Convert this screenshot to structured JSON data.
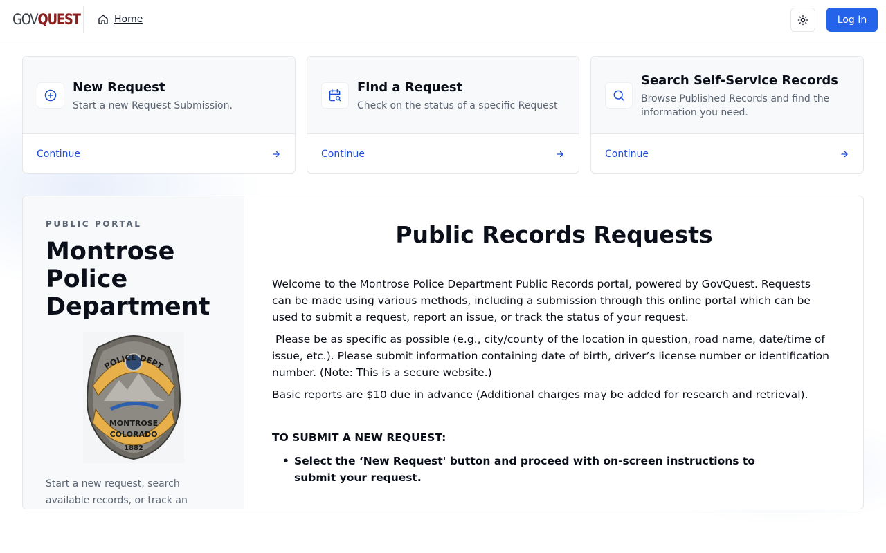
{
  "header": {
    "logo_gov": "GOV",
    "logo_quest": "QUEST",
    "home_label": "Home",
    "login_label": "Log In"
  },
  "cards": [
    {
      "title": "New Request",
      "desc": "Start a new Request Submission.",
      "cta": "Continue",
      "icon": "plus-circle-icon"
    },
    {
      "title": "Find a Request",
      "desc": "Check on the status of a specific Request",
      "cta": "Continue",
      "icon": "calendar-search-icon"
    },
    {
      "title": "Search Self-Service Records",
      "desc": "Browse Published Records and find the information you need.",
      "cta": "Continue",
      "icon": "search-icon"
    }
  ],
  "sidebar": {
    "label": "PUBLIC PORTAL",
    "org_name": "Montrose Police Department",
    "badge_top": "POLICE DEPT",
    "badge_city": "MONTROSE",
    "badge_state": "COLORADO",
    "badge_year": "1882",
    "footer_text": "Start a new request, search available records, or track an"
  },
  "main": {
    "title": "Public Records Requests",
    "p1": "Welcome to the Montrose Police Department Public Records portal, powered by GovQuest. Requests can be made using various methods, including a submission through this online portal which can be used to submit a request, report an issue, or track the status of your request.",
    "p2": " Please be as specific as possible (e.g., city/county of the location in question, road name, date/time of issue, etc.). Please submit information containing date of birth, driver’s license number or identification number. (Note: This is a secure website.)",
    "p3": "Basic reports are $10 due in advance (Additional charges may be added for research and retrieval).",
    "submit_heading": "TO SUBMIT A NEW REQUEST:",
    "bullet1": "Select the ‘New Request' button and proceed with on-screen instructions to submit your request."
  },
  "colors": {
    "primary": "#2563eb",
    "link": "#1d4ed8",
    "brand_red": "#8b1e1e",
    "badge_gold": "#e8b04a"
  }
}
